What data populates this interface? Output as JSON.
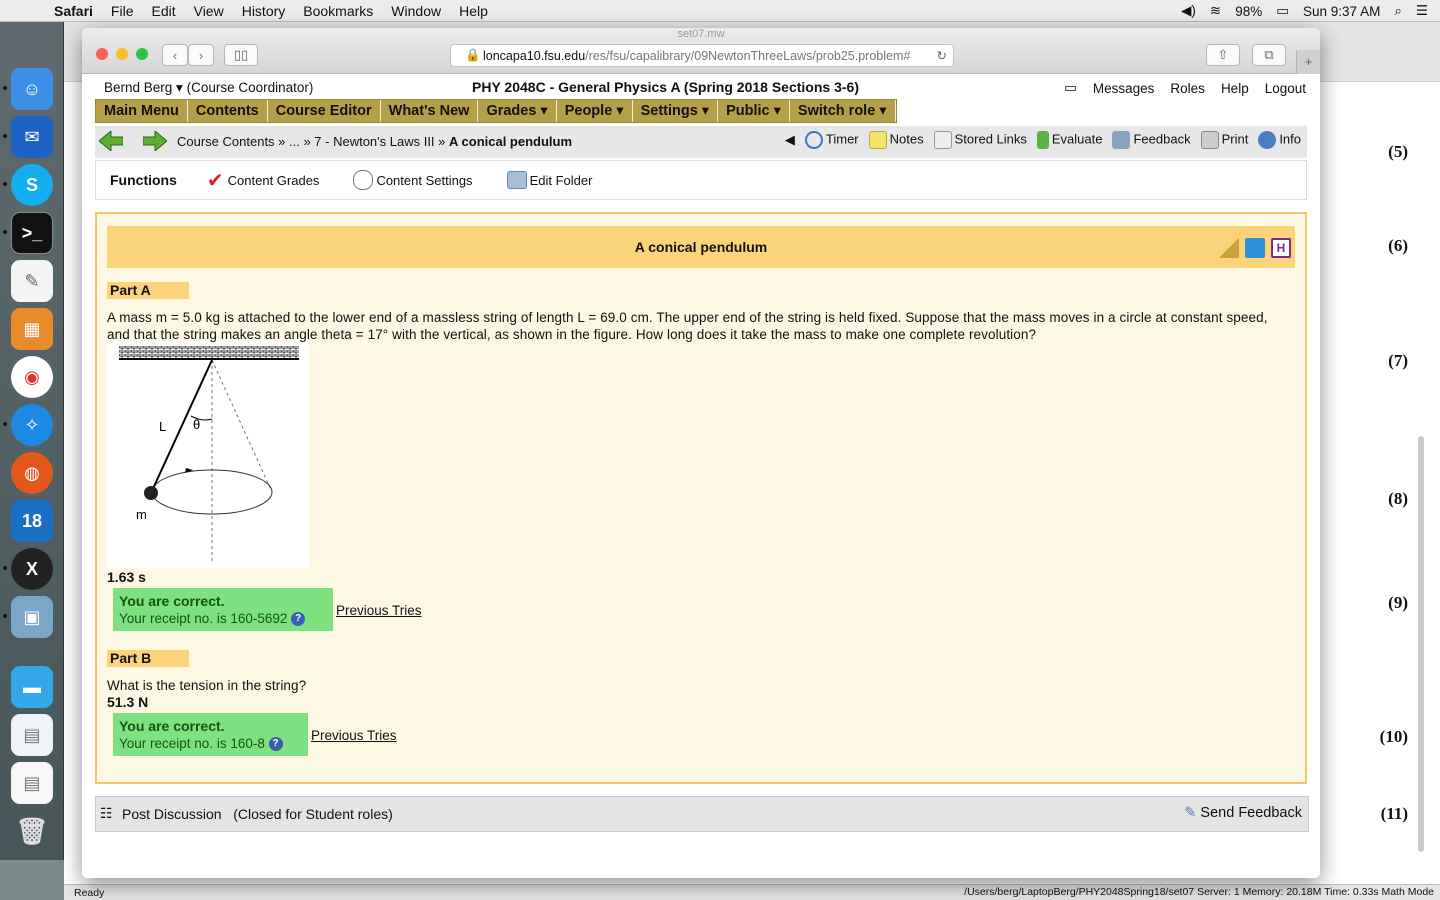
{
  "os_menu": {
    "app": "Safari",
    "items": [
      "File",
      "Edit",
      "View",
      "History",
      "Bookmarks",
      "Window",
      "Help"
    ],
    "battery": "98%",
    "clock": "Sun 9:37 AM"
  },
  "bg_window": {
    "equation_numbers": [
      "(5)",
      "(6)",
      "(7)",
      "(8)",
      "(9)",
      "(10)",
      "(11)"
    ],
    "status_left": "Ready",
    "status_right": "/Users/berg/LaptopBerg/PHY2048Spring18/set07   Server: 1   Memory: 20.18M   Time: 0.33s   Math Mode"
  },
  "browser": {
    "tab_title": "set07.mw",
    "url_host": "loncapa10.fsu.edu",
    "url_path": "/res/fsu/capalibrary/09NewtonThreeLaws/prob25.problem#"
  },
  "lc": {
    "user": "Bernd Berg ▾  (Course Coordinator)",
    "course": "PHY 2048C - General Physics A (Spring 2018 Sections 3-6)",
    "top_links": [
      "Messages",
      "Roles",
      "Help",
      "Logout"
    ],
    "main_menu": [
      "Main Menu",
      "Contents",
      "Course Editor",
      "What's New",
      "Grades ▾",
      "People ▾",
      "Settings ▾",
      "Public ▾",
      "Switch role ▾"
    ],
    "breadcrumb_prefix": "Course Contents » ... » 7 - Newton's Laws III » ",
    "breadcrumb_current": "A conical pendulum",
    "tools": [
      "Timer",
      "Notes",
      "Stored Links",
      "Evaluate",
      "Feedback",
      "Print",
      "Info"
    ],
    "functions_label": "Functions",
    "functions": [
      "Content Grades",
      "Content Settings",
      "Edit Folder"
    ]
  },
  "problem": {
    "title": "A conical pendulum",
    "partA": {
      "header": "Part A",
      "text": "A mass m = 5.0 kg is attached to the lower end of a massless string of length L = 69.0 cm. The upper end of the string is held fixed. Suppose that the mass moves in a circle at constant speed, and that the string makes an angle theta = 17° with the vertical, as shown in the figure. How long does it take the mass to make one complete revolution?",
      "answer": "1.63 s",
      "correct": "You are correct.",
      "receipt": "Your receipt no. is 160-5692",
      "prev": "Previous Tries"
    },
    "figure": {
      "L": "L",
      "theta": "θ",
      "m": "m"
    },
    "partB": {
      "header": "Part B",
      "text": "What is the tension in the string?",
      "answer": "51.3 N",
      "correct": "You are correct.",
      "receipt": "Your receipt no. is 160-8",
      "prev": "Previous Tries"
    }
  },
  "discussion": {
    "post": "Post Discussion   (Closed for Student roles)",
    "send": "Send Feedback"
  }
}
